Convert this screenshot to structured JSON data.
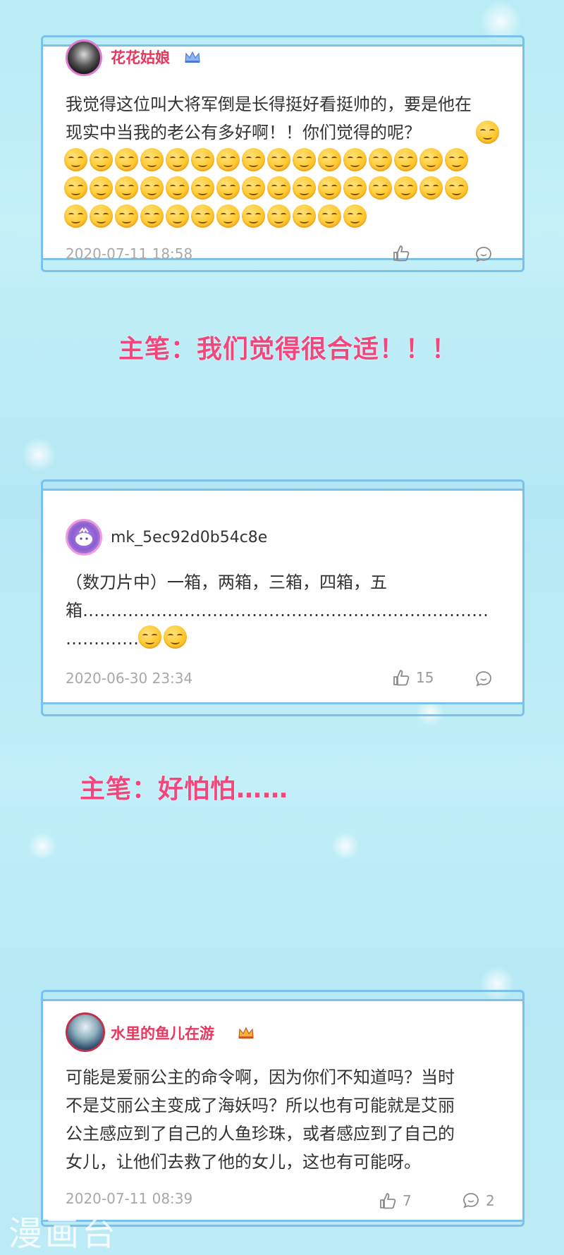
{
  "comments": [
    {
      "username": "花花姑娘",
      "username_color": "#e8365d",
      "crown_icon": "vip-crown-blue-icon",
      "text": "我觉得这位叫大将军倒是长得挺好看挺帅的，要是他在现实中当我的老公有多好啊！！你们觉得的呢？",
      "emoji_icon": "smirk-emoji-icon",
      "date": "2020-07-11 18:58",
      "like_count": "",
      "reply_count": ""
    },
    {
      "username": "mk_5ec92d0b54c8e",
      "username_color": "#333333",
      "text_line1": "（数刀片中）一箱，两箱，三箱，四箱，五",
      "text_line2": "箱………………………………………………………………",
      "text_line3": "……………",
      "emoji_icon": "relieved-emoji-icon",
      "date": "2020-06-30 23:34",
      "like_count": "15",
      "reply_count": ""
    },
    {
      "username": "水里的鱼儿在游",
      "username_color": "#e8365d",
      "crown_icon": "vip-crown-gold-icon",
      "text_lines": [
        "可能是爱丽公主的命令啊，因为你们不知道吗？当时",
        "不是艾丽公主变成了海妖吗？所以也有可能就是艾丽",
        "公主感应到了自己的人鱼珍珠，或者感应到了自己的",
        "女儿，让他们去救了他的女儿，这也有可能呀。"
      ],
      "date": "2020-07-11 08:39",
      "like_count": "7",
      "reply_count": "2"
    }
  ],
  "captions": {
    "first": "主笔：我们觉得很合适！！！",
    "second": "主笔：好怕怕……"
  },
  "watermark": "漫画台"
}
